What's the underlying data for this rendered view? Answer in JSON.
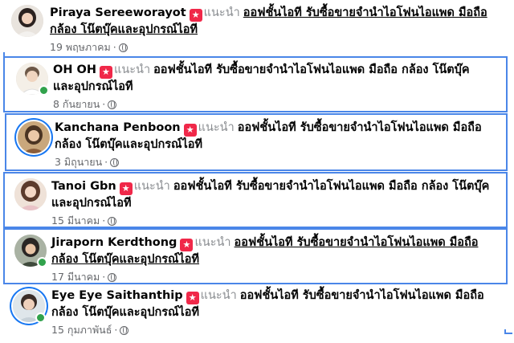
{
  "recommend_label": "แนะนำ",
  "post_title_line1": "ออฟชั้นไอที รับซื้อขายจำนำไอโฟนไอแพด มือถือ",
  "post_title_line2": "กล้อง โน๊ตบุ๊คและอุปกรณ์ไอที",
  "post_title_line1_alt": "ออฟชั้นไอที รับซื้อขายจำนำไอโฟนไอแพด มือถือ กล้อง โน๊ตบุ๊ค",
  "post_title_line2_alt": "และอุปกรณ์ไอที",
  "post_title_line1_oh": "ออฟชั้นไอที รับซื้อขายจำนำไอโฟนไอแพด มือถือ กล้อง โน๊ตบุ๊ค",
  "post_title_line2_oh": "และอุปกรณ์ไอที",
  "reviews": [
    {
      "name": "Piraya Sereeworayot",
      "date": "19 พฤษภาคม"
    },
    {
      "name": "OH OH",
      "date": "8 กันยายน"
    },
    {
      "name": "Kanchana Penboon",
      "date": "3 มิถุนายน"
    },
    {
      "name": "Tanoi Gbn",
      "date": "15 มีนาคม"
    },
    {
      "name": "Jiraporn Kerdthong",
      "date": "17 มีนาคม"
    },
    {
      "name": "Eye Eye Saithanthip",
      "date": "15 กุมภาพันธ์"
    }
  ],
  "colors": {
    "accent_frame": "#4a86e8",
    "recommend_star": "#f02849",
    "online": "#31a24c"
  },
  "icons": {
    "recommend": "star-icon",
    "privacy": "globe-icon"
  }
}
